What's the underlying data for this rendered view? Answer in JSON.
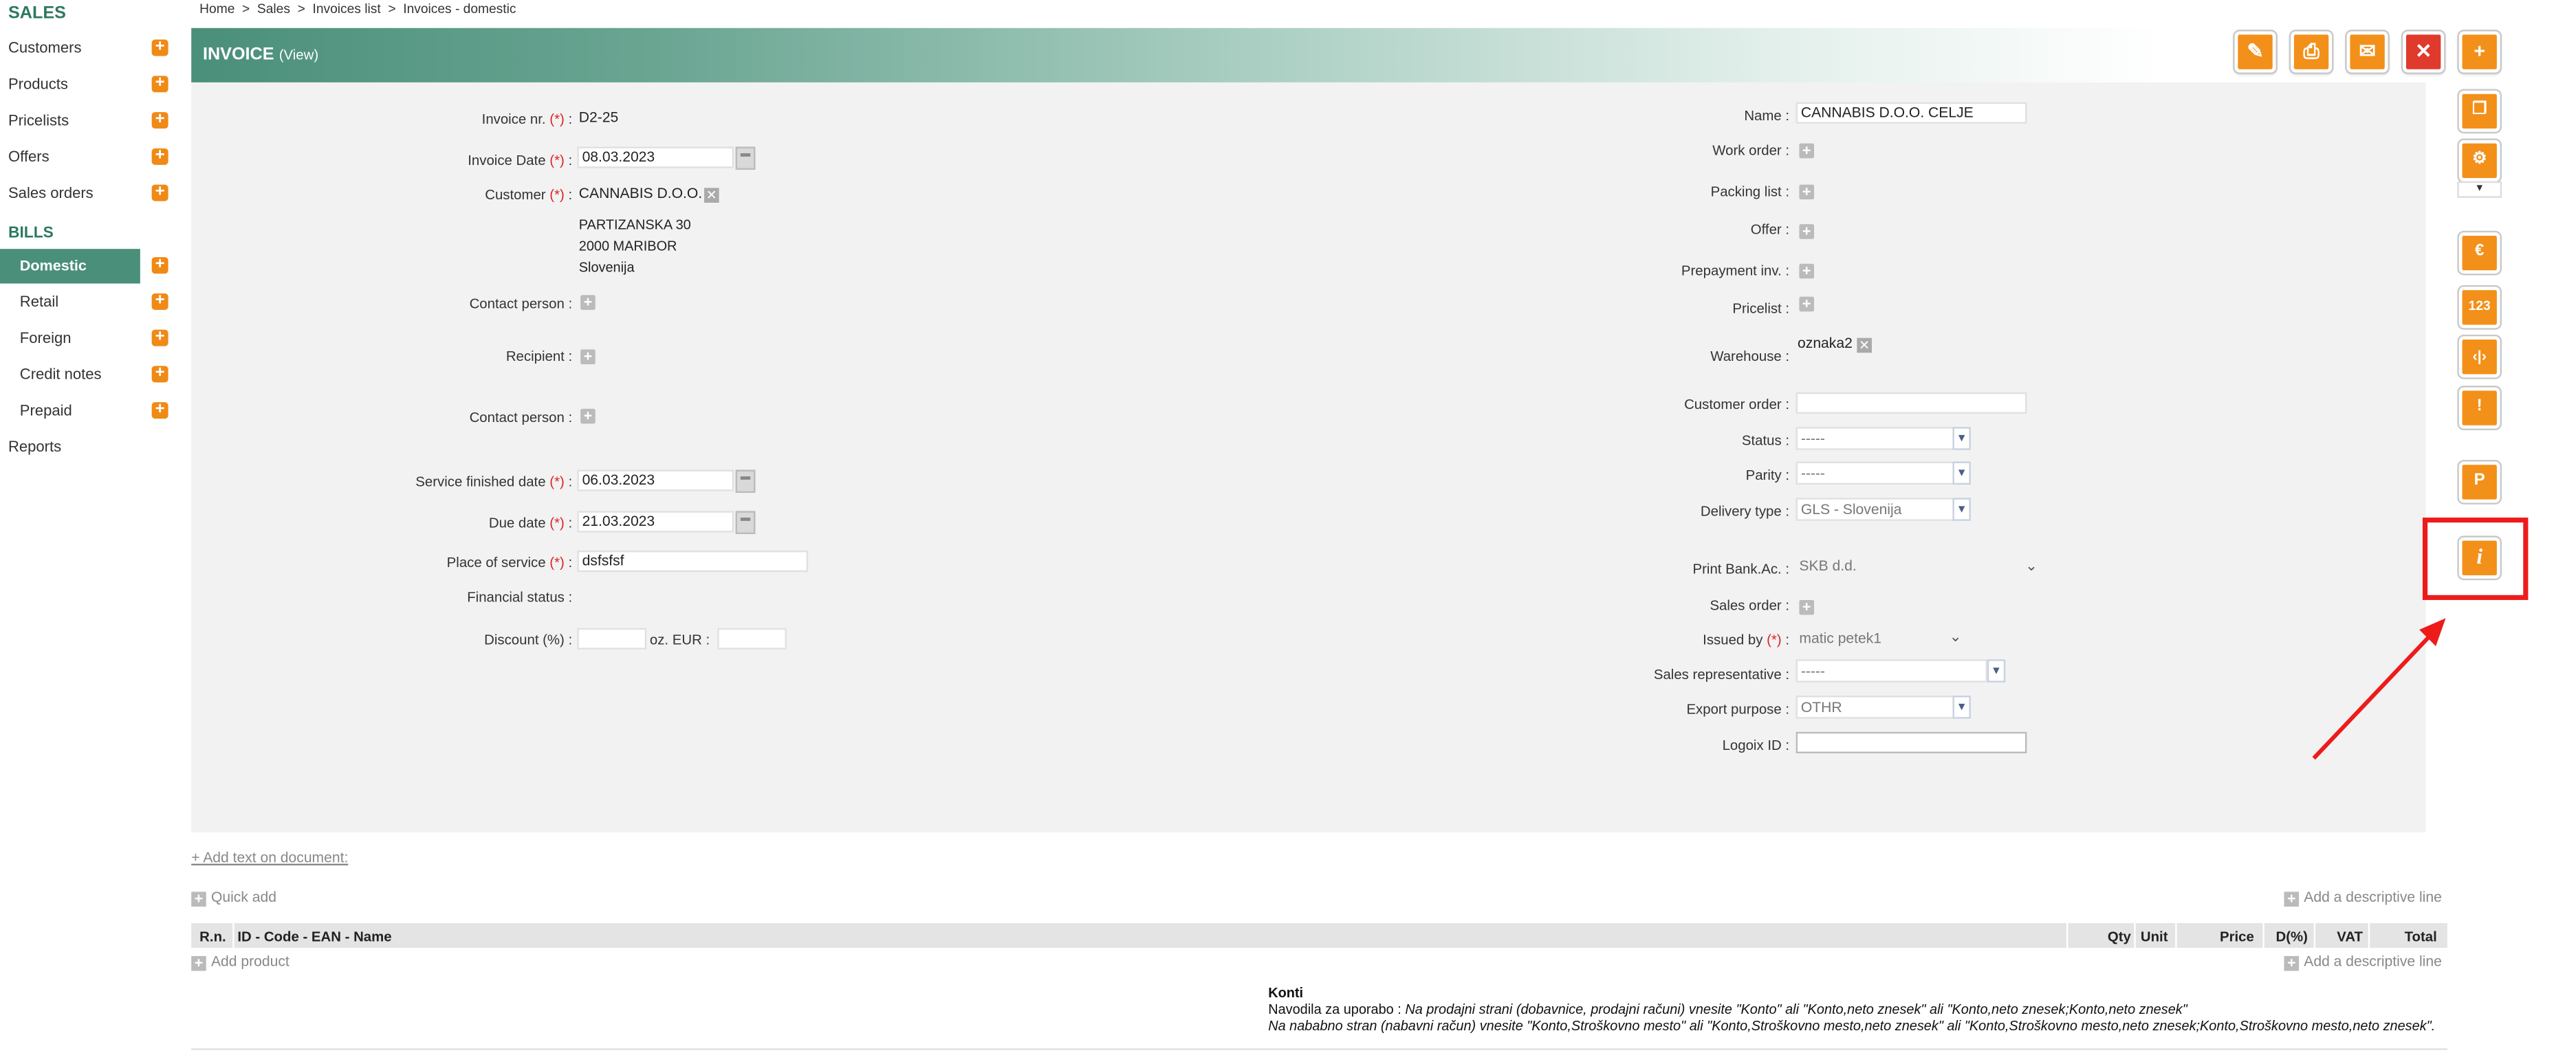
{
  "sidebar": {
    "title": "SALES",
    "sales_items": [
      "Customers",
      "Products",
      "Pricelists",
      "Offers",
      "Sales orders"
    ],
    "bills_title": "BILLS",
    "bills_items": [
      "Domestic",
      "Retail",
      "Foreign",
      "Credit notes",
      "Prepaid"
    ],
    "reports": "Reports"
  },
  "breadcrumb": {
    "items": [
      "Home",
      "Sales",
      "Invoices list",
      "Invoices - domestic"
    ],
    "sep": ">"
  },
  "header": {
    "title": "INVOICE",
    "subtitle": "(View)"
  },
  "req_mark": "(*)",
  "left": {
    "invoice_nr": {
      "label": "Invoice nr.",
      "value": "D2-25"
    },
    "invoice_date": {
      "label": "Invoice Date",
      "value": "08.03.2023"
    },
    "customer": {
      "label": "Customer",
      "value": "CANNABIS D.O.O.",
      "addr1": "PARTIZANSKA 30",
      "addr2": "2000 MARIBOR",
      "addr3": "Slovenija"
    },
    "contact_person": {
      "label": "Contact person :"
    },
    "recipient": {
      "label": "Recipient :"
    },
    "contact_person2": {
      "label": "Contact person :"
    },
    "service_finished": {
      "label": "Service finished date",
      "value": "06.03.2023"
    },
    "due_date": {
      "label": "Due date",
      "value": "21.03.2023"
    },
    "place_of_service": {
      "label": "Place of service",
      "value": "dsfsfsf"
    },
    "financial_status": {
      "label": "Financial status :"
    },
    "discount": {
      "label": "Discount (%) :",
      "oz_label": "oz. EUR :"
    }
  },
  "right": {
    "name": {
      "label": "Name :",
      "value": "CANNABIS D.O.O. CELJE"
    },
    "work_order": "Work order :",
    "packing_list": "Packing list :",
    "offer": "Offer :",
    "prepayment": "Prepayment inv. :",
    "pricelist": "Pricelist :",
    "warehouse": {
      "label": "Warehouse :",
      "value": "oznaka2"
    },
    "customer_order": "Customer order :",
    "status": {
      "label": "Status :",
      "value": "-----"
    },
    "parity": {
      "label": "Parity :",
      "value": "-----"
    },
    "delivery_type": {
      "label": "Delivery type :",
      "value": "GLS - Slovenija"
    },
    "print_bank": {
      "label": "Print Bank.Ac. :",
      "value": "SKB d.d."
    },
    "sales_order": "Sales order :",
    "issued_by": {
      "label": "Issued by",
      "value": "matic petek1"
    },
    "sales_rep": {
      "label": "Sales representative :",
      "value": "-----"
    },
    "export_purpose": {
      "label": "Export purpose :",
      "value": "OTHR"
    },
    "logoix": "Logoix ID :"
  },
  "links": {
    "add_text": "+ Add text on document:",
    "quick_add": "Quick add",
    "add_descriptive": "Add a descriptive line",
    "add_product": "Add product"
  },
  "table": {
    "headers": [
      "R.n.",
      "ID - Code - EAN - Name",
      "Qty",
      "Unit",
      "Price",
      "D(%)",
      "VAT",
      "Total"
    ]
  },
  "konti": {
    "title": "Konti",
    "line1_prefix": "Navodila za uporabo : ",
    "line1": "Na prodajni strani (dobavnice, prodajni računi) vnesite \"Konto\" ali \"Konto,neto znesek\" ali \"Konto,neto znesek;Konto,neto znesek\"",
    "line2": "Na nababno stran (nabavni račun) vnesite \"Konto,Stroškovno mesto\" ali \"Konto,Stroškovno mesto,neto znesek\" ali \"Konto,Stroškovno mesto,neto znesek;Konto,Stroškovno mesto,neto znesek\"."
  },
  "icons": {
    "toolbar": [
      "edit-icon",
      "print-icon",
      "email-icon",
      "delete-icon",
      "add-icon"
    ],
    "right": [
      "copy-icon",
      "settings-icon",
      "euro-icon",
      "numbers-icon",
      "split-icon",
      "warning-icon",
      "p-icon",
      "info-icon"
    ]
  },
  "colors": {
    "accent": "#4a8f7a",
    "orange": "#f39019",
    "red": "#e03a2d",
    "highlight": "#ee1b1b"
  }
}
